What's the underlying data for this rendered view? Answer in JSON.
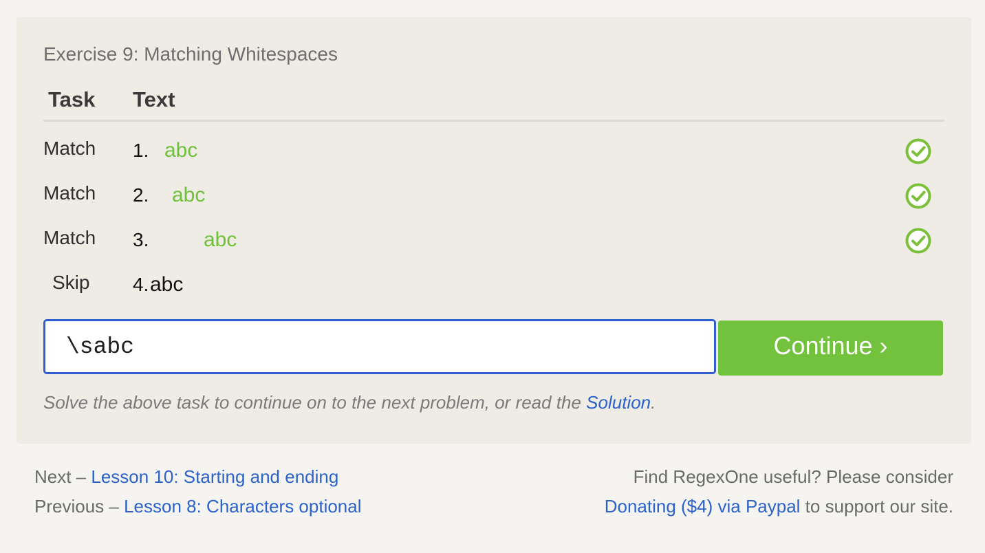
{
  "exercise": {
    "title": "Exercise 9: Matching Whitespaces"
  },
  "table": {
    "header_task": "Task",
    "header_text": "Text",
    "rows": [
      {
        "task": "Match",
        "number": "1.",
        "text": "abc",
        "status": "matched"
      },
      {
        "task": "Match",
        "number": "2.",
        "text": "abc",
        "status": "matched"
      },
      {
        "task": "Match",
        "number": "3.",
        "text": "abc",
        "status": "matched"
      },
      {
        "task": "Skip",
        "number": "4.",
        "text": "abc",
        "status": "none"
      }
    ]
  },
  "regex_input": {
    "value": "\\sabc"
  },
  "continue_button": {
    "label": "Continue ›"
  },
  "hint": {
    "text": "Solve the above task to continue on to the next problem, or read the ",
    "link": "Solution",
    "suffix": "."
  },
  "footer": {
    "next_prefix": "Next – ",
    "next_link": "Lesson 10: Starting and ending",
    "previous_prefix": "Previous – ",
    "previous_link": "Lesson 8: Characters optional",
    "support_line1": "Find RegexOne useful? Please consider",
    "support_link": "Donating ($4) via Paypal",
    "support_suffix": " to support our site."
  },
  "colors": {
    "match_green": "#6fc03a",
    "button_green": "#72c23d",
    "link_blue": "#2d62c9",
    "input_border": "#2f5fd0"
  },
  "icons": {
    "row_status": "check-circle-icon"
  }
}
